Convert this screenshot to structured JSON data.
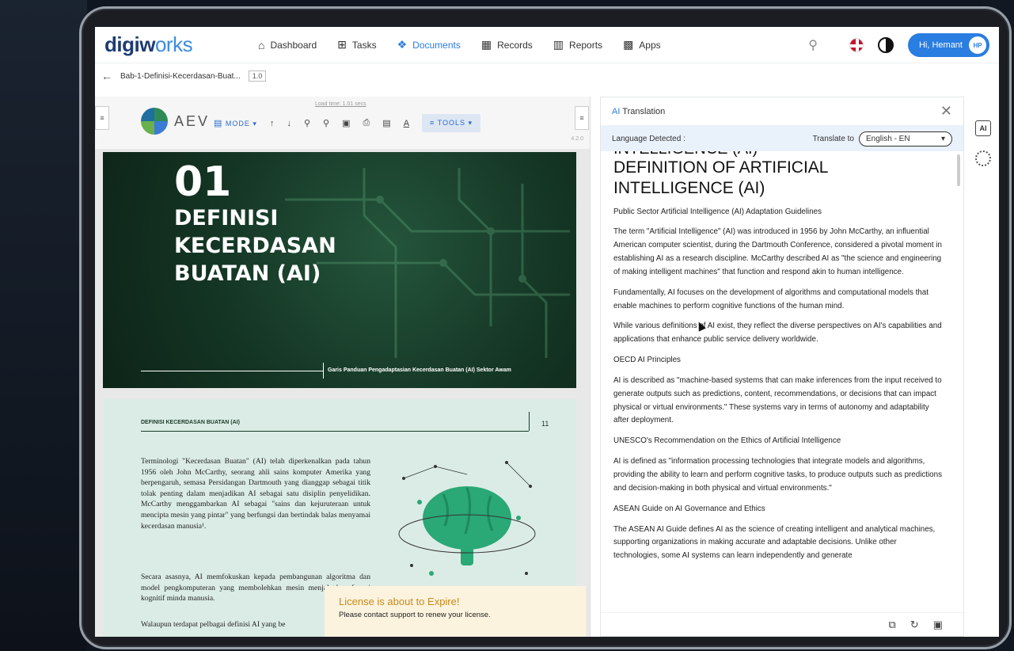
{
  "app": {
    "logo": {
      "part1": "digiw",
      "part2": "rks",
      "o": "o"
    },
    "nav": [
      {
        "label": "Dashboard",
        "icon": "home-icon",
        "glyph": "⌂",
        "active": false
      },
      {
        "label": "Tasks",
        "icon": "tasks-icon",
        "glyph": "⊞",
        "active": false
      },
      {
        "label": "Documents",
        "icon": "documents-icon",
        "glyph": "❖",
        "active": true
      },
      {
        "label": "Records",
        "icon": "records-icon",
        "glyph": "▦",
        "active": false
      },
      {
        "label": "Reports",
        "icon": "reports-icon",
        "glyph": "▥",
        "active": false
      },
      {
        "label": "Apps",
        "icon": "apps-icon",
        "glyph": "▩",
        "active": false
      }
    ],
    "user": {
      "greeting": "Hi, Hemant",
      "initials": "HP"
    },
    "accent": "#2a7de1"
  },
  "breadcrumb": {
    "filename": "Bab-1-Definisi-Kecerdasan-Buat...",
    "version": "1.0"
  },
  "viewer": {
    "brand": "AEV",
    "mode_label": "MODE ▾",
    "tools_label": "≡ TOOLS ▾",
    "load_time": "Load time: 1.01 secs",
    "zoom": "4.2.0",
    "cover": {
      "number": "01",
      "title_lines": [
        "DEFINISI",
        "KECERDASAN",
        "BUATAN (AI)"
      ],
      "subtitle": "Garis Panduan Pengadaptasian Kecerdasan Buatan (AI) Sektor Awam"
    },
    "page2": {
      "header": "DEFINISI KECERDASAN BUATAN (AI)",
      "page_number": "11",
      "para1": "Terminologi \"Kecerdasan Buatan\" (AI) telah diperkenalkan pada tahun 1956 oleh John McCarthy, seorang ahli sains komputer Amerika yang berpengaruh, semasa Persidangan Dartmouth yang dianggap sebagai titik tolak penting dalam menjadikan AI sebagai satu disiplin penyelidikan. McCarthy menggambarkan AI sebagai \"sains dan kejuruteraan untuk mencipta mesin yang pintar\" yang berfungsi dan bertindak balas menyamai kecerdasan manusia¹.",
      "para2": "Secara asasnya, AI memfokuskan kepada pembangunan algoritma dan model pengkomputeran yang membolehkan mesin menjalankan fungsi kognitif minda manusia.",
      "para3": "Walaupun terdapat pelbagai definisi AI yang be"
    },
    "toast": {
      "title": "License is about to Expire!",
      "message": "Please contact support to renew your license."
    }
  },
  "translation": {
    "title_prefix": "AI",
    "title": " Translation",
    "detected_label": "Language Detected :",
    "translate_to_label": "Translate to",
    "target_language": "English - EN",
    "cut_heading": "INTELLIGENCE (AI)",
    "heading": "DEFINITION OF ARTIFICIAL INTELLIGENCE (AI)",
    "paragraphs": [
      "Public Sector Artificial Intelligence (AI) Adaptation Guidelines",
      "The term \"Artificial Intelligence\" (AI) was introduced in 1956 by John McCarthy, an influential American computer scientist, during the Dartmouth Conference, considered a pivotal moment in establishing AI as a research discipline. McCarthy described AI as \"the science and engineering of making intelligent machines\" that function and respond akin to human intelligence.",
      "Fundamentally, AI focuses on the development of algorithms and computational models that enable machines to perform cognitive functions of the human mind.",
      "While various definitions of AI exist, they reflect the diverse perspectives on AI's capabilities and applications that enhance public service delivery worldwide.",
      "OECD AI Principles",
      "AI is described as \"machine-based systems that can make inferences from the input received to generate outputs such as predictions, content, recommendations, or decisions that can impact physical or virtual environments.\" These systems vary in terms of autonomy and adaptability after deployment.",
      "UNESCO's Recommendation on the Ethics of Artificial Intelligence",
      "AI is defined as \"information processing technologies that integrate models and algorithms, providing the ability to learn and perform cognitive tasks, to produce outputs such as predictions and decision-making in both physical and virtual environments.\"",
      "ASEAN Guide on AI Governance and Ethics",
      "The ASEAN AI Guide defines AI as the science of creating intelligent and analytical machines, supporting organizations in making accurate and adaptable decisions. Unlike other technologies, some AI systems can learn independently and generate"
    ]
  }
}
